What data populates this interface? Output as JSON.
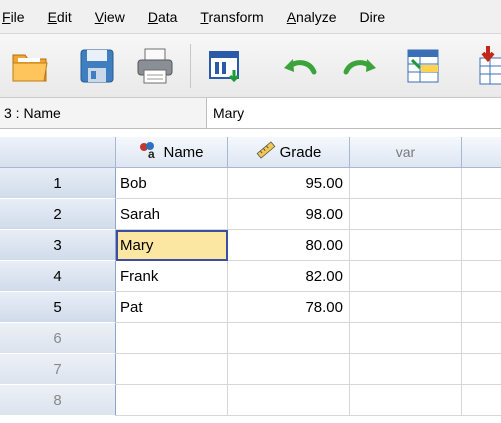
{
  "menu": [
    {
      "label": "File",
      "u": "F",
      "rest": "ile"
    },
    {
      "label": "Edit",
      "u": "E",
      "rest": "dit"
    },
    {
      "label": "View",
      "u": "V",
      "rest": "iew"
    },
    {
      "label": "Data",
      "u": "D",
      "rest": "ata"
    },
    {
      "label": "Transform",
      "u": "T",
      "rest": "ransform"
    },
    {
      "label": "Analyze",
      "u": "A",
      "rest": "nalyze"
    },
    {
      "label": "Dire",
      "u": "",
      "rest": "Dire"
    }
  ],
  "cellbar": {
    "ref": "3 : Name",
    "value": "Mary"
  },
  "columns": [
    {
      "label": "Name",
      "icon": "nominal-measure-icon"
    },
    {
      "label": "Grade",
      "icon": "scale-ruler-icon"
    },
    {
      "label": "var",
      "icon": ""
    }
  ],
  "rows": [
    {
      "num": "1",
      "name": "Bob",
      "grade": "95.00"
    },
    {
      "num": "2",
      "name": "Sarah",
      "grade": "98.00"
    },
    {
      "num": "3",
      "name": "Mary",
      "grade": "80.00"
    },
    {
      "num": "4",
      "name": "Frank",
      "grade": "82.00"
    },
    {
      "num": "5",
      "name": "Pat",
      "grade": "78.00"
    },
    {
      "num": "6",
      "name": "",
      "grade": ""
    },
    {
      "num": "7",
      "name": "",
      "grade": ""
    },
    {
      "num": "8",
      "name": "",
      "grade": ""
    }
  ],
  "selected_cell": {
    "row": "3",
    "column": "Name"
  },
  "toolbar_icons": [
    "open-folder-icon",
    "save-icon",
    "print-icon",
    "dialog-recall-icon",
    "undo-icon",
    "redo-icon",
    "goto-case-icon",
    "insert-variable-icon"
  ]
}
